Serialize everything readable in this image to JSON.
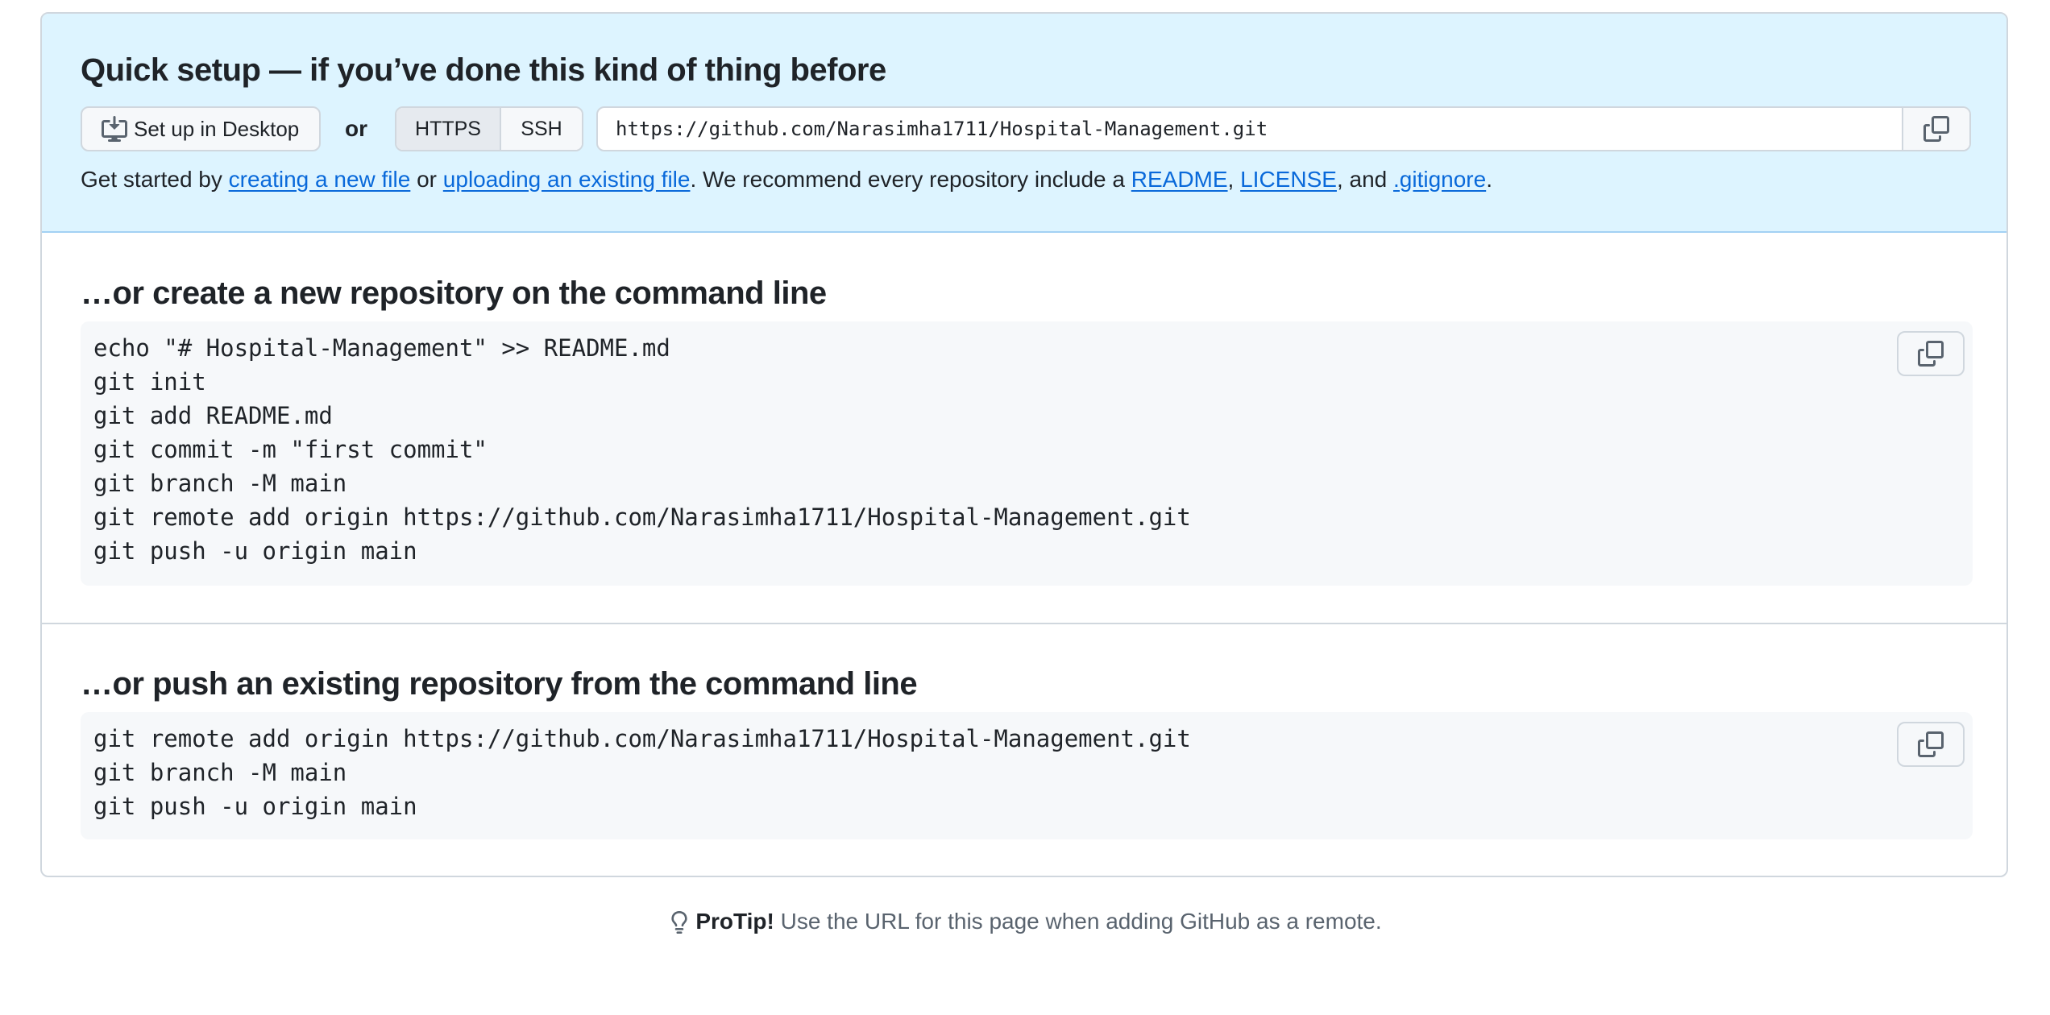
{
  "quick_setup": {
    "title": "Quick setup — if you’ve done this kind of thing before",
    "desktop_button": "Set up in Desktop",
    "or_label": "or",
    "protocols": [
      "HTTPS",
      "SSH"
    ],
    "selected_protocol": "HTTPS",
    "clone_url": "https://github.com/Narasimha1711/Hospital-Management.git",
    "intro": {
      "t1": "Get started by ",
      "link_new_file": "creating a new file",
      "t2": " or ",
      "link_upload": "uploading an existing file",
      "t3": ". We recommend every repository include a ",
      "link_readme": "README",
      "t4": ", ",
      "link_license": "LICENSE",
      "t5": ", and ",
      "link_gitignore": ".gitignore",
      "t6": "."
    }
  },
  "create_section": {
    "title": "…or create a new repository on the command line",
    "lines": [
      "echo \"# Hospital-Management\" >> README.md",
      "git init",
      "git add README.md",
      "git commit -m \"first commit\"",
      "git branch -M main",
      "git remote add origin https://github.com/Narasimha1711/Hospital-Management.git",
      "git push -u origin main"
    ]
  },
  "push_section": {
    "title": "…or push an existing repository from the command line",
    "lines": [
      "git remote add origin https://github.com/Narasimha1711/Hospital-Management.git",
      "git branch -M main",
      "git push -u origin main"
    ]
  },
  "protip": {
    "label": "ProTip!",
    "text": " Use the URL for this page when adding GitHub as a remote."
  },
  "icons": {
    "desktop": "desktop-download-icon",
    "copy": "copy-icon",
    "protip": "light-bulb-icon"
  },
  "colors": {
    "link": "#0969da",
    "quick_setup_bg": "#ddf4ff",
    "code_bg": "#f6f8fa",
    "border": "#d0d7de"
  }
}
